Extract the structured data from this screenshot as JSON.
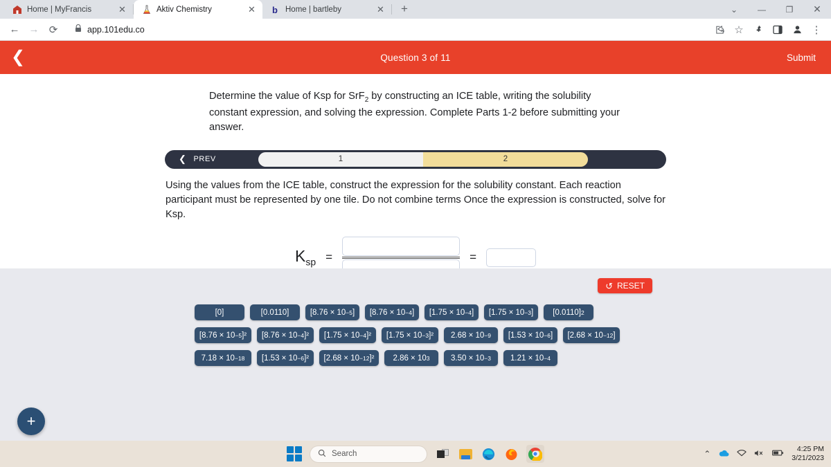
{
  "browser": {
    "tabs": [
      {
        "title": "Home | MyFrancis",
        "favicon": "🏠",
        "active": false,
        "close": "✕"
      },
      {
        "title": "Aktiv Chemistry",
        "favicon": "🧪",
        "active": true,
        "close": "✕"
      },
      {
        "title": "Home | bartleby",
        "favicon": "b",
        "active": false,
        "close": "✕"
      }
    ],
    "new_tab_label": "+",
    "window_controls": {
      "minimize_tabs": "⌄",
      "minimize": "—",
      "maximize": "❐",
      "close": "✕"
    },
    "nav": {
      "back": "←",
      "forward": "→",
      "reload": "⟳"
    },
    "address": {
      "lock_icon": "🔒",
      "url": "app.101edu.co"
    },
    "toolbar_icons": {
      "share": "⇪",
      "bookmark": "☆",
      "extensions": "🧩",
      "side_panel": "▥",
      "profile": "👤",
      "menu": "⋮"
    }
  },
  "app_header": {
    "back_icon": "❮",
    "title": "Question 3 of 11",
    "submit_label": "Submit",
    "bar_color": "#e8412a"
  },
  "question": {
    "prompt_part1": "Determine the value of Ksp for SrF",
    "prompt_sub": "2",
    "prompt_part2": " by constructing an ICE table, writing the solubility constant expression, and solving the expression. Complete Parts 1-2 before submitting your answer.",
    "parts_bar": {
      "prev_label": "PREV",
      "prev_chevron": "❮",
      "parts": [
        {
          "label": "1",
          "state": "completed"
        },
        {
          "label": "2",
          "state": "current"
        }
      ]
    },
    "sub_prompt": "Using the values from the ICE table, construct the expression for the solubility constant. Each reaction participant must be represented by one tile. Do not combine terms Once the expression is constructed, solve for Ksp.",
    "expression": {
      "ksp_symbol": "K",
      "ksp_subscript": "sp",
      "equals_1": "=",
      "equals_2": "=",
      "numerator_value": "",
      "denominator_value": "",
      "answer_value": ""
    }
  },
  "tray": {
    "reset_label": "RESET",
    "reset_icon": "↺",
    "reset_color": "#ee3b2b",
    "tile_color": "#34506f",
    "tiles": [
      {
        "base": "[0]",
        "exp": "",
        "suffix": "",
        "width": "w-0"
      },
      {
        "base": "[0.0110]",
        "exp": "",
        "suffix": "",
        "width": "w-0"
      },
      {
        "base": "[8.76 × 10",
        "exp": "−5",
        "suffix": "]",
        "width": "w-1"
      },
      {
        "base": "[8.76 × 10",
        "exp": "−4",
        "suffix": "]",
        "width": "w-1"
      },
      {
        "base": "[1.75 × 10",
        "exp": "−4",
        "suffix": "]",
        "width": "w-1"
      },
      {
        "base": "[1.75 × 10",
        "exp": "−3",
        "suffix": "]",
        "width": "w-1"
      },
      {
        "base": "[0.0110]",
        "exp": "2",
        "suffix": "",
        "width": "w-0"
      },
      {
        "base": "[8.76 × 10",
        "exp": "−5",
        "suffix": "]²",
        "width": "w-2"
      },
      {
        "base": "[8.76 × 10",
        "exp": "−4",
        "suffix": "]²",
        "width": "w-2"
      },
      {
        "base": "[1.75 × 10",
        "exp": "−4",
        "suffix": "]²",
        "width": "w-2"
      },
      {
        "base": "[1.75 × 10",
        "exp": "−3",
        "suffix": "]²",
        "width": "w-2"
      },
      {
        "base": "2.68 × 10",
        "exp": "−9",
        "suffix": "",
        "width": "w-1"
      },
      {
        "base": "[1.53 × 10",
        "exp": "−6",
        "suffix": "]",
        "width": "w-1"
      },
      {
        "base": "[2.68 × 10",
        "exp": "−12",
        "suffix": "]",
        "width": "w-2"
      },
      {
        "base": "7.18 × 10",
        "exp": "−18",
        "suffix": "",
        "width": "w-2"
      },
      {
        "base": "[1.53 × 10",
        "exp": "−6",
        "suffix": "]²",
        "width": "w-2"
      },
      {
        "base": "[2.68 × 10",
        "exp": "−12",
        "suffix": "]²",
        "width": "w-3"
      },
      {
        "base": "2.86 × 10",
        "exp": "3",
        "suffix": "",
        "width": "w-1"
      },
      {
        "base": "3.50 × 10",
        "exp": "−3",
        "suffix": "",
        "width": "w-1"
      },
      {
        "base": "1.21 × 10",
        "exp": "−4",
        "suffix": "",
        "width": "w-1"
      }
    ],
    "add_button_label": "+"
  },
  "taskbar": {
    "search_placeholder": "Search",
    "search_icon": "🔍",
    "apps": [
      "task-view",
      "file-explorer",
      "edge",
      "firefox",
      "chrome"
    ],
    "tray": {
      "overflow": "⌃",
      "onedrive": "☁",
      "wifi": "📶",
      "volume": "🔇",
      "battery": "🔋"
    },
    "time": "4:25 PM",
    "date": "3/21/2023"
  }
}
